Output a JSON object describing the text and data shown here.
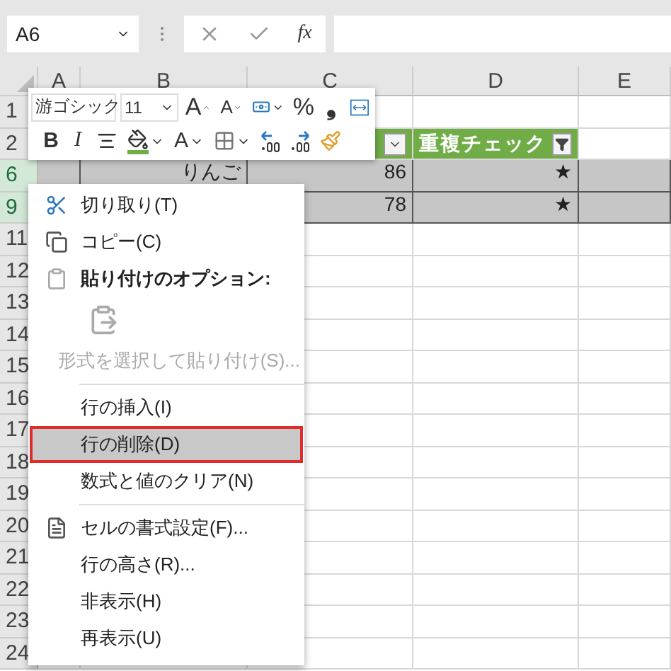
{
  "formula_bar": {
    "name_box": "A6",
    "fx": "fx"
  },
  "columns": [
    "A",
    "B",
    "C",
    "D",
    "E"
  ],
  "rows": [
    {
      "label": "1",
      "selected": false
    },
    {
      "label": "2",
      "selected": false,
      "cells": [
        {},
        {},
        {
          "kind": "filter-header",
          "filtered": false
        },
        {
          "kind": "filter-header",
          "text": "重複チェック",
          "filtered": true
        },
        {}
      ]
    },
    {
      "label": "6",
      "selected": true,
      "cells": [
        {},
        {
          "text": "りんご"
        },
        {
          "text": "86"
        },
        {
          "text": "★"
        },
        {}
      ]
    },
    {
      "label": "9",
      "selected": true,
      "cells": [
        {},
        {},
        {
          "text": "78"
        },
        {
          "text": "★"
        },
        {}
      ]
    },
    {
      "label": "11",
      "selected": false
    },
    {
      "label": "12",
      "selected": false
    },
    {
      "label": "13",
      "selected": false
    },
    {
      "label": "14",
      "selected": false
    },
    {
      "label": "15",
      "selected": false
    },
    {
      "label": "16",
      "selected": false
    },
    {
      "label": "17",
      "selected": false
    },
    {
      "label": "18",
      "selected": false
    },
    {
      "label": "19",
      "selected": false
    },
    {
      "label": "20",
      "selected": false
    },
    {
      "label": "21",
      "selected": false
    },
    {
      "label": "22",
      "selected": false
    },
    {
      "label": "23",
      "selected": false
    },
    {
      "label": "24",
      "selected": false
    }
  ],
  "mini_toolbar": {
    "font": "游ゴシック",
    "size": "11",
    "row_1": [
      {
        "kind": "grow",
        "label": "A"
      },
      {
        "kind": "shrink",
        "label": "A"
      },
      {
        "kind": "number-format",
        "caret": true
      },
      {
        "kind": "percent",
        "label": "%"
      },
      {
        "kind": "comma",
        "label": "❟"
      },
      {
        "kind": "wrap"
      }
    ],
    "row_2": [
      {
        "kind": "bold",
        "label": "B"
      },
      {
        "kind": "italic",
        "label": "I"
      },
      {
        "kind": "align"
      },
      {
        "kind": "fill",
        "caret": true
      },
      {
        "kind": "font-color",
        "label": "A",
        "caret": true
      },
      {
        "kind": "borders",
        "caret": true
      },
      {
        "kind": "increase-decimal"
      },
      {
        "kind": "decrease-decimal"
      },
      {
        "kind": "format-painter"
      }
    ]
  },
  "context_menu": [
    {
      "kind": "cut",
      "label": "切り取り(T)",
      "selected": false,
      "disabled": false
    },
    {
      "kind": "copy",
      "label": "コピー(C)",
      "selected": false,
      "disabled": false
    },
    {
      "kind": "header",
      "label": "貼り付けのオプション:"
    },
    {
      "kind": "paste-option"
    },
    {
      "kind": "item",
      "label": "形式を選択して貼り付け(S)...",
      "selected": false,
      "disabled": true
    },
    {
      "kind": "separator"
    },
    {
      "kind": "item",
      "label": "行の挿入(I)",
      "selected": false,
      "disabled": false
    },
    {
      "kind": "item",
      "label": "行の削除(D)",
      "selected": true,
      "disabled": false
    },
    {
      "kind": "item",
      "label": "数式と値のクリア(N)",
      "selected": false,
      "disabled": false
    },
    {
      "kind": "separator"
    },
    {
      "kind": "format-cells",
      "label": "セルの書式設定(F)...",
      "selected": false,
      "disabled": false
    },
    {
      "kind": "item",
      "label": "行の高さ(R)...",
      "selected": false,
      "disabled": false
    },
    {
      "kind": "item",
      "label": "非表示(H)",
      "selected": false,
      "disabled": false
    },
    {
      "kind": "item",
      "label": "再表示(U)",
      "selected": false,
      "disabled": false
    }
  ]
}
